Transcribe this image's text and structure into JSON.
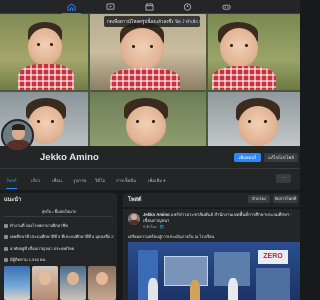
{
  "nav": {
    "icons": [
      "home-icon",
      "video-icon",
      "marketplace-icon",
      "groups-icon",
      "gaming-icon"
    ],
    "active": "home-icon"
  },
  "cover": {
    "hint_text": "กดเพื่อดาวน์โหลดรูปนี้ลงแล้วลงชื่อโปรไฟล์ได้ด้วย",
    "hint_close": "ปิด",
    "hint_action": "ทำเลิก"
  },
  "profile": {
    "name": "Jekko Amino",
    "add_story_label": "เพิ่มสตอรี่",
    "edit_profile_label": "แก้ไขโปรไฟล์"
  },
  "tabs": [
    {
      "label": "โพสต์",
      "active": true
    },
    {
      "label": "เกี่ยว",
      "active": false
    },
    {
      "label": "เพื่อน",
      "active": false
    },
    {
      "label": "รูปภาพ",
      "active": false
    },
    {
      "label": "วิดีโอ",
      "active": false
    },
    {
      "label": "การเช็คอิน",
      "active": false
    },
    {
      "label": "เพิ่มเติม ▾",
      "active": false
    }
  ],
  "tab_more_label": "···",
  "intro": {
    "title": "แนะนำ",
    "bio": "สุขใจ • ยิ้มสดใสมาก",
    "items": [
      "ทำงานที่ กองโรงพยาบาลฝึกอาชีพ",
      "เคยศึกษาที่ ประถมศึกษาปีที่ 5 ที่ประถมศึกษาปีที่ 6 มุดลงชื่อ 2",
      "อาศัยอยู่ที่ เขื่อนกาญจนา ประเทศไทย",
      "มีผู้ติดตาม 1,518 คน"
    ]
  },
  "posts": {
    "title": "โพสต์",
    "filter_label": "ตัวกรอง",
    "manage_label": "จัดการโพสต์",
    "author": "Jekko Amino",
    "headline": "แชร์ข่าวประชาสัมพันธ์ สำนักงานเขตพื้นที่การศึกษาประถมศึกษา เขื่อนกาญจนา",
    "meta": "9 ชั่วโมง · 🌐",
    "body": "เตรียมความพร้อมสู่การประเมินภายใน ณ โรงเรียน",
    "more_icon": "more-icon",
    "image_sign": "ZERO"
  },
  "colors": {
    "background": "#18191a",
    "card": "#242526",
    "accent": "#2d88ff",
    "text": "#e4e6eb",
    "muted": "#b0b3b8"
  }
}
